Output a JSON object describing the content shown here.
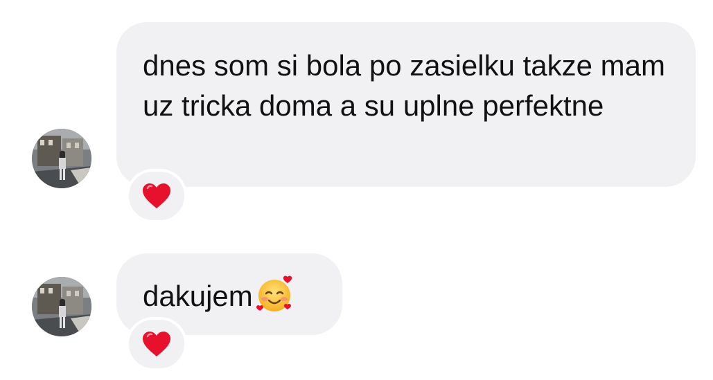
{
  "messages": [
    {
      "text": "dnes som si bola po zasielku takze mam uz tricka doma a su uplne perfektne",
      "reaction": "red-heart-icon"
    },
    {
      "text": "dakujem",
      "emoji": "smiling-face-with-hearts-icon",
      "reaction": "red-heart-icon"
    }
  ],
  "colors": {
    "bubble_background": "#f1f1f3",
    "text": "#111111",
    "heart": "#e8112d"
  }
}
